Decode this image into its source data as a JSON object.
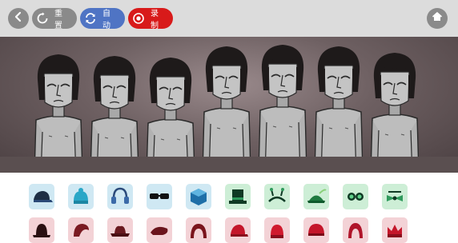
{
  "toolbar": {
    "back_icon": "chevron-left-icon",
    "reset_label": "重置",
    "reset_icon": "reset-circle-icon",
    "auto_label": "自动",
    "auto_icon": "refresh-icon",
    "record_label": "录制",
    "record_icon": "record-dot-icon",
    "home_icon": "home-icon"
  },
  "colors": {
    "toolbar_bg": "#dcdcdc",
    "reset_bg": "#8a8a8a",
    "auto_bg": "#4f74c4",
    "record_bg": "#d81a1a",
    "beat_slot_bg": "#cfe8f3",
    "effect_slot_bg": "#cdeed6",
    "melody_slot_bg": "#f3d2d6"
  },
  "stage": {
    "performer_count": 7
  },
  "palette": {
    "row1": [
      {
        "icon": "cap-icon",
        "group": "beats"
      },
      {
        "icon": "beanie-icon",
        "group": "beats"
      },
      {
        "icon": "headphones-icon",
        "group": "beats"
      },
      {
        "icon": "sunglasses-icon",
        "group": "beats"
      },
      {
        "icon": "cube-icon",
        "group": "beats"
      },
      {
        "icon": "top-hat-icon",
        "group": "effects"
      },
      {
        "icon": "antenna-headband-icon",
        "group": "effects"
      },
      {
        "icon": "feather-hat-icon",
        "group": "effects"
      },
      {
        "icon": "goggles-icon",
        "group": "effects"
      },
      {
        "icon": "bow-ribbon-icon",
        "group": "effects"
      }
    ],
    "row2": [
      {
        "icon": "bowler-hat-icon",
        "group": "melodies"
      },
      {
        "icon": "hair-swoop-icon",
        "group": "melodies"
      },
      {
        "icon": "fedora-icon",
        "group": "melodies"
      },
      {
        "icon": "beret-icon",
        "group": "melodies"
      },
      {
        "icon": "wig-icon",
        "group": "melodies"
      },
      {
        "icon": "red-cap-icon",
        "group": "melodies"
      },
      {
        "icon": "red-beanie-icon",
        "group": "melodies"
      },
      {
        "icon": "red-helmet-icon",
        "group": "melodies"
      },
      {
        "icon": "red-hood-icon",
        "group": "melodies"
      },
      {
        "icon": "red-crown-icon",
        "group": "melodies"
      }
    ]
  }
}
